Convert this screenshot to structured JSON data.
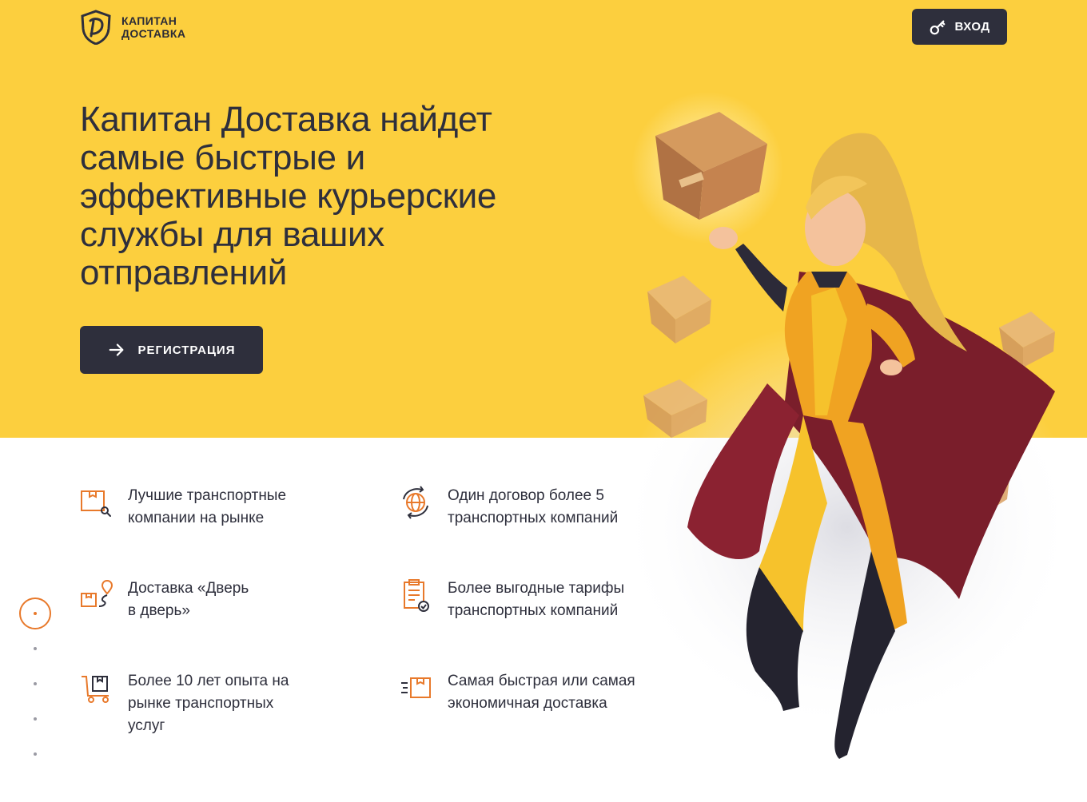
{
  "header": {
    "logo_line1": "КАПИТАН",
    "logo_line2": "ДОСТАВКА",
    "login_label": "ВХОД",
    "login_icon": "key-icon"
  },
  "hero": {
    "headline": "Капитан Доставка найдет самые быстрые и эффективные курьерские службы для ваших отправлений",
    "register_label": "РЕГИСТРАЦИЯ",
    "register_icon": "arrow-right-icon"
  },
  "features": [
    {
      "icon": "box-search-icon",
      "text": "Лучшие транспортные\nкомпании на рынке"
    },
    {
      "icon": "globe-sync-icon",
      "text": "Один договор более 5\nтранспортных компаний"
    },
    {
      "icon": "box-route-icon",
      "text": "Доставка «Дверь\nв дверь»"
    },
    {
      "icon": "clipboard-check-icon",
      "text": "Более выгодные тарифы\nтранспортных компаний"
    },
    {
      "icon": "cart-box-icon",
      "text": "Более 10 лет опыта на\nрынке транспортных\nуслуг"
    },
    {
      "icon": "fast-box-icon",
      "text": "Самая быстрая или самая\nэкономичная доставка"
    }
  ],
  "pagination": {
    "active_index": 0,
    "total": 5
  },
  "colors": {
    "hero_bg": "#fccf3e",
    "dark": "#2e2f3c",
    "accent": "#e8792b"
  }
}
